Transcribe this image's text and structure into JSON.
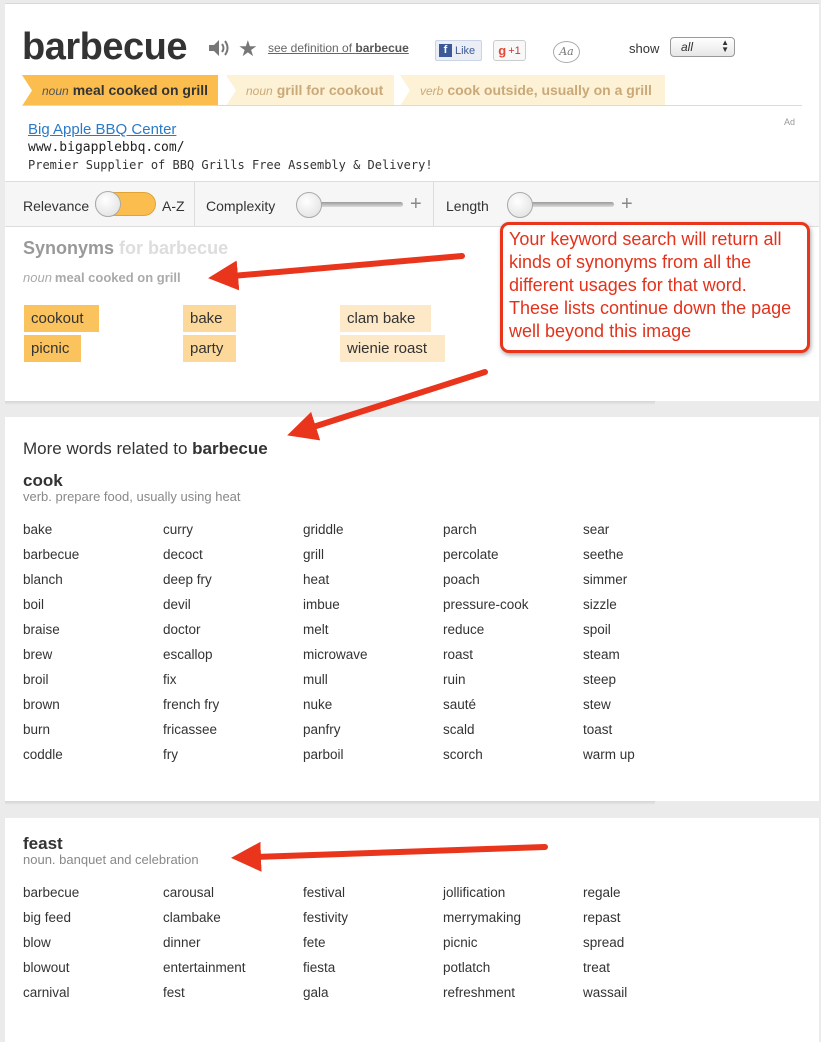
{
  "header": {
    "word": "barbecue",
    "see_definition_prefix": "see definition of",
    "see_definition_word": "barbecue",
    "fb_like": "Like",
    "gplus": "+1",
    "font_toggle": "Aa",
    "show_label": "show",
    "show_value": "all"
  },
  "senses": [
    {
      "pos": "noun",
      "label": "meal cooked on grill"
    },
    {
      "pos": "noun",
      "label": "grill for cookout"
    },
    {
      "pos": "verb",
      "label": "cook outside, usually on a grill"
    }
  ],
  "ad": {
    "title": "Big Apple BBQ Center",
    "url": "www.bigapplebbq.com/",
    "description": "Premier Supplier of BBQ Grills Free Assembly & Delivery!",
    "tag": "Ad"
  },
  "filters": {
    "relevance": "Relevance",
    "az": "A-Z",
    "complexity": "Complexity",
    "length": "Length",
    "plus": "+"
  },
  "synonyms": {
    "heading": "Synonyms",
    "heading_for": "for barbecue",
    "sense_pos": "noun",
    "sense_label": "meal cooked on grill",
    "words": [
      "cookout",
      "bake",
      "clam bake",
      "picnic",
      "party",
      "wienie roast"
    ]
  },
  "callout": {
    "text": "Your keyword search will return all kinds of synonyms from all the different usages for that word. These lists continue down the page well beyond this image"
  },
  "related": {
    "heading_prefix": "More words related to",
    "heading_word": "barbecue"
  },
  "groups": [
    {
      "word": "cook",
      "gloss": "verb. prepare food, usually using heat",
      "columns": [
        [
          "bake",
          "barbecue",
          "blanch",
          "boil",
          "braise",
          "brew",
          "broil",
          "brown",
          "burn",
          "coddle"
        ],
        [
          "curry",
          "decoct",
          "deep fry",
          "devil",
          "doctor",
          "escallop",
          "fix",
          "french fry",
          "fricassee",
          "fry"
        ],
        [
          "griddle",
          "grill",
          "heat",
          "imbue",
          "melt",
          "microwave",
          "mull",
          "nuke",
          "panfry",
          "parboil"
        ],
        [
          "parch",
          "percolate",
          "poach",
          "pressure-cook",
          "reduce",
          "roast",
          "ruin",
          "sauté",
          "scald",
          "scorch"
        ],
        [
          "sear",
          "seethe",
          "simmer",
          "sizzle",
          "spoil",
          "steam",
          "steep",
          "stew",
          "toast",
          "warm up"
        ]
      ]
    },
    {
      "word": "feast",
      "gloss": "noun. banquet and celebration",
      "columns": [
        [
          "barbecue",
          "big feed",
          "blow",
          "blowout",
          "carnival"
        ],
        [
          "carousal",
          "clambake",
          "dinner",
          "entertainment",
          "fest"
        ],
        [
          "festival",
          "festivity",
          "fete",
          "fiesta",
          "gala"
        ],
        [
          "jollification",
          "merrymaking",
          "picnic",
          "potlatch",
          "refreshment"
        ],
        [
          "regale",
          "repast",
          "spread",
          "treat",
          "wassail"
        ]
      ]
    }
  ],
  "colors": {
    "accent": "#fbbd4e",
    "accent_light": "#fdf1d6",
    "link": "#2a7ac7",
    "annotation": "#e8351c"
  }
}
